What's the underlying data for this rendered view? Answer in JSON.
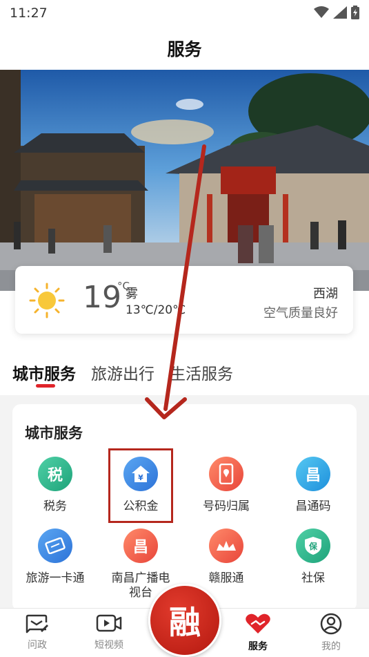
{
  "status_bar": {
    "time": "11:27"
  },
  "header": {
    "title": "服务"
  },
  "weather": {
    "temperature": "19",
    "unit": "°C",
    "condition": "雾",
    "range": "13℃/20℃",
    "location": "西湖",
    "air_quality": "空气质量良好"
  },
  "tabs": [
    {
      "label": "城市服务",
      "active": true
    },
    {
      "label": "旅游出行",
      "active": false
    },
    {
      "label": "生活服务",
      "active": false
    }
  ],
  "section": {
    "title": "城市服务",
    "items": [
      {
        "label": "税务",
        "icon": "tax-icon",
        "color": "#27b68a"
      },
      {
        "label": "公积金",
        "icon": "house-fund-icon",
        "color": "#3a86e8"
      },
      {
        "label": "号码归属",
        "icon": "phone-location-icon",
        "color": "#f0614d"
      },
      {
        "label": "昌通码",
        "icon": "changtong-code-icon",
        "color": "#2aa4e6"
      },
      {
        "label": "旅游一卡通",
        "icon": "travel-card-icon",
        "color": "#3a86e8"
      },
      {
        "label": "南昌广播电视台",
        "icon": "broadcast-icon",
        "color": "#f0614d"
      },
      {
        "label": "赣服通",
        "icon": "ganfutong-icon",
        "color": "#f0614d"
      },
      {
        "label": "社保",
        "icon": "social-security-icon",
        "color": "#27b68a"
      }
    ]
  },
  "bottom_nav": [
    {
      "label": "问政",
      "icon": "message-edit-icon"
    },
    {
      "label": "短视频",
      "icon": "video-icon"
    },
    {
      "label": "",
      "icon": "rong-logo-icon",
      "glyph": "融"
    },
    {
      "label": "服务",
      "icon": "heart-hands-icon",
      "active": true
    },
    {
      "label": "我的",
      "icon": "profile-icon"
    }
  ]
}
